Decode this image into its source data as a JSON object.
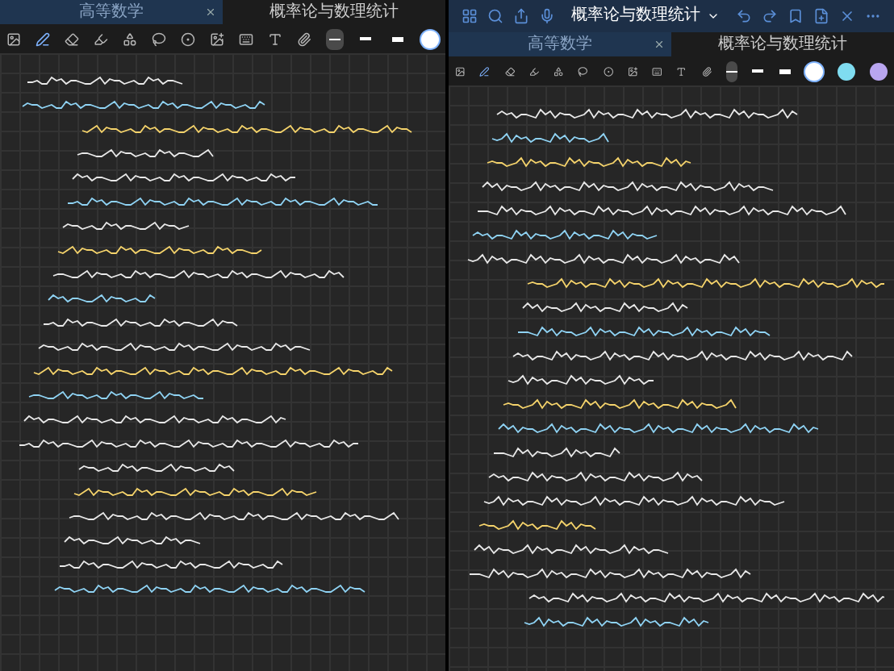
{
  "panes": [
    {
      "tabs": [
        {
          "label": "高等数学",
          "selected": false
        },
        {
          "label": "概率论与数理统计",
          "selected": true
        }
      ],
      "tools": [
        {
          "kind": "image",
          "selected": false
        },
        {
          "kind": "pen",
          "selected": true
        },
        {
          "kind": "eraser",
          "selected": false
        },
        {
          "kind": "highlighter",
          "selected": false
        },
        {
          "kind": "shapes",
          "selected": false
        },
        {
          "kind": "lasso",
          "selected": false
        },
        {
          "kind": "record",
          "selected": false
        },
        {
          "kind": "photo",
          "selected": false
        },
        {
          "kind": "keyboard",
          "selected": false
        },
        {
          "kind": "text",
          "selected": false
        },
        {
          "kind": "clip",
          "selected": false
        }
      ],
      "stroke_widths": [
        {
          "selected": true
        },
        {
          "selected": false
        },
        {
          "selected": false
        }
      ],
      "colors": [
        {
          "color": "#ffffff",
          "selected": true
        }
      ]
    },
    {
      "title": "概率论与数理统计",
      "tabs": [
        {
          "label": "高等数学",
          "selected": false
        },
        {
          "label": "概率论与数理统计",
          "selected": true
        }
      ],
      "tools": [
        {
          "kind": "image",
          "selected": false
        },
        {
          "kind": "pen",
          "selected": true
        },
        {
          "kind": "eraser",
          "selected": false
        },
        {
          "kind": "highlighter",
          "selected": false
        },
        {
          "kind": "shapes",
          "selected": false
        },
        {
          "kind": "lasso",
          "selected": false
        },
        {
          "kind": "record",
          "selected": false
        },
        {
          "kind": "photo",
          "selected": false
        },
        {
          "kind": "keyboard",
          "selected": false
        },
        {
          "kind": "text",
          "selected": false
        },
        {
          "kind": "clip",
          "selected": false
        }
      ],
      "stroke_widths": [
        {
          "selected": true
        },
        {
          "selected": false
        },
        {
          "selected": false
        }
      ],
      "colors": [
        {
          "color": "#ffffff",
          "selected": true
        },
        {
          "color": "#7fdcf0",
          "selected": false
        },
        {
          "color": "#b9a6f0",
          "selected": false
        }
      ]
    }
  ]
}
